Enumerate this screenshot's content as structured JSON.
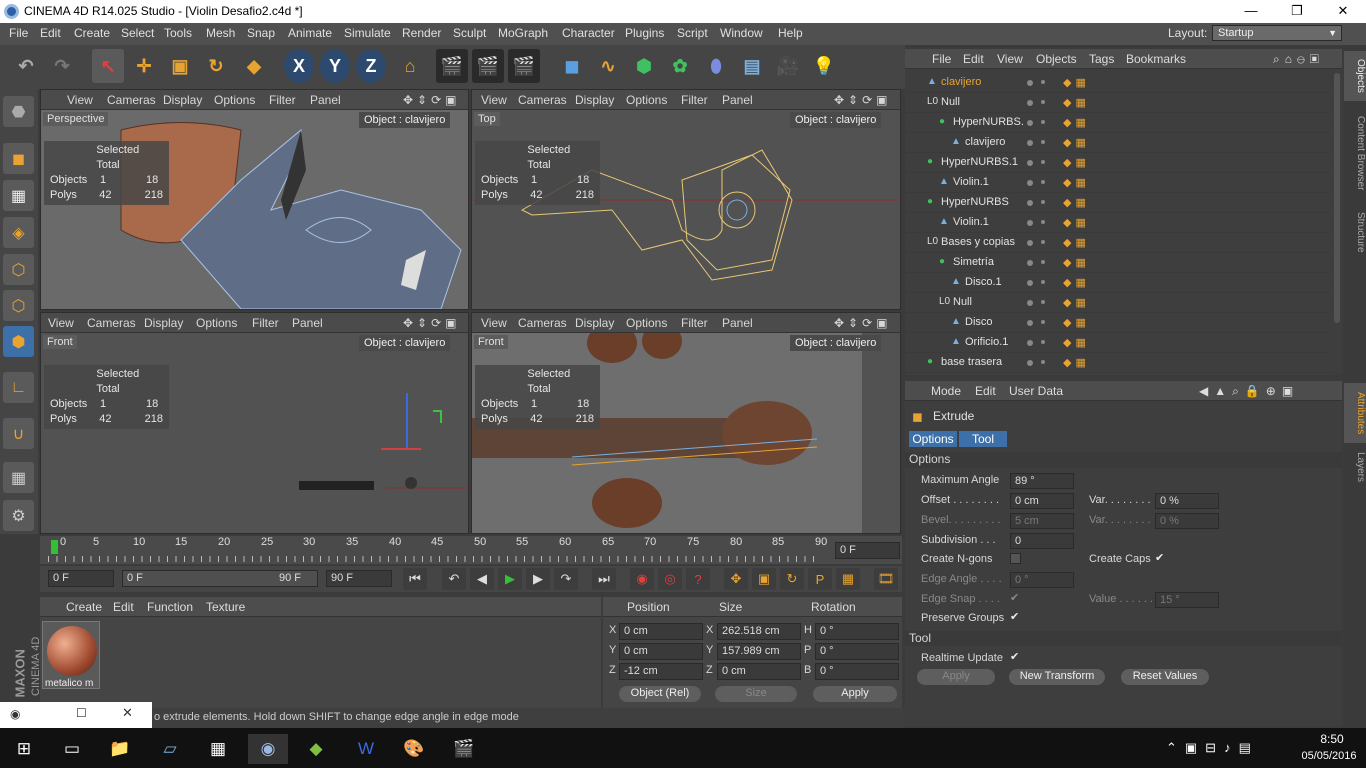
{
  "window": {
    "title": "CINEMA 4D R14.025 Studio - [Violin Desafio2.c4d *]",
    "minimize": "—",
    "restore": "❐",
    "close": "✕"
  },
  "menu": [
    "File",
    "Edit",
    "Create",
    "Select",
    "Tools",
    "Mesh",
    "Snap",
    "Animate",
    "Simulate",
    "Render",
    "Sculpt",
    "MoGraph",
    "Character",
    "Plugins",
    "Script",
    "Window",
    "Help"
  ],
  "layout": {
    "label": "Layout:",
    "value": "Startup"
  },
  "viewport_menu": [
    "View",
    "Cameras",
    "Display",
    "Options",
    "Filter",
    "Panel"
  ],
  "viewports": [
    {
      "name": "Perspective",
      "object": "Object : clavijero",
      "stats": {
        "header": "Selected Total",
        "objects_label": "Objects",
        "objects_sel": "1",
        "objects_total": "18",
        "polys_label": "Polys",
        "polys_sel": "42",
        "polys_total": "218"
      }
    },
    {
      "name": "Top",
      "object": "Object : clavijero",
      "stats": {
        "header": "Selected Total",
        "objects_label": "Objects",
        "objects_sel": "1",
        "objects_total": "18",
        "polys_label": "Polys",
        "polys_sel": "42",
        "polys_total": "218"
      }
    },
    {
      "name": "Front",
      "object": "Object : clavijero",
      "stats": {
        "header": "Selected Total",
        "objects_label": "Objects",
        "objects_sel": "1",
        "objects_total": "18",
        "polys_label": "Polys",
        "polys_sel": "42",
        "polys_total": "218"
      }
    },
    {
      "name": "Front",
      "object": "Object : clavijero",
      "stats": {
        "header": "Selected Total",
        "objects_label": "Objects",
        "objects_sel": "1",
        "objects_total": "18",
        "polys_label": "Polys",
        "polys_sel": "42",
        "polys_total": "218"
      }
    }
  ],
  "timeline": {
    "ticks": [
      "0",
      "5",
      "10",
      "15",
      "20",
      "25",
      "30",
      "35",
      "40",
      "45",
      "50",
      "55",
      "60",
      "65",
      "70",
      "75",
      "80",
      "85",
      "90"
    ],
    "frame_field": "0 F"
  },
  "transport": {
    "start": "0 F",
    "slider_left": "0 F",
    "slider_right": "90 F",
    "end": "90 F"
  },
  "material_menu": [
    "Create",
    "Edit",
    "Function",
    "Texture"
  ],
  "material": {
    "name": "metalico m"
  },
  "coords": {
    "headers": [
      "Position",
      "Size",
      "Rotation"
    ],
    "rows": [
      {
        "axis": "X",
        "pos": "0 cm",
        "saxis": "X",
        "size": "262.518 cm",
        "raxis": "H",
        "rot": "0 °"
      },
      {
        "axis": "Y",
        "pos": "0 cm",
        "saxis": "Y",
        "size": "157.989 cm",
        "raxis": "P",
        "rot": "0 °"
      },
      {
        "axis": "Z",
        "pos": "-12 cm",
        "saxis": "Z",
        "size": "0 cm",
        "raxis": "B",
        "rot": "0 °"
      }
    ],
    "mode": "Object (Rel)",
    "size_mode": "Size",
    "apply": "Apply"
  },
  "status": "o extrude elements. Hold down SHIFT to change edge angle in edge mode",
  "objects_menu": [
    "File",
    "Edit",
    "View",
    "Objects",
    "Tags",
    "Bookmarks"
  ],
  "objects": [
    {
      "name": "clavijero",
      "indent": 0,
      "icon": "▲",
      "color": "#e8a330"
    },
    {
      "name": "Null",
      "indent": 0,
      "icon": "L0",
      "color": "#e2e2e2"
    },
    {
      "name": "HyperNURBS.",
      "indent": 1,
      "icon": "●",
      "color": "#e2e2e2"
    },
    {
      "name": "clavijero",
      "indent": 2,
      "icon": "▲",
      "color": "#e2e2e2"
    },
    {
      "name": "HyperNURBS.1",
      "indent": 0,
      "icon": "●",
      "color": "#e2e2e2"
    },
    {
      "name": "Violin.1",
      "indent": 1,
      "icon": "▲",
      "color": "#e2e2e2"
    },
    {
      "name": "HyperNURBS",
      "indent": 0,
      "icon": "●",
      "color": "#e2e2e2"
    },
    {
      "name": "Violin.1",
      "indent": 1,
      "icon": "▲",
      "color": "#e2e2e2"
    },
    {
      "name": "Bases y copias",
      "indent": 0,
      "icon": "L0",
      "color": "#e2e2e2"
    },
    {
      "name": "Simetría",
      "indent": 1,
      "icon": "●",
      "color": "#e2e2e2"
    },
    {
      "name": "Disco.1",
      "indent": 2,
      "icon": "▲",
      "color": "#e2e2e2"
    },
    {
      "name": "Null",
      "indent": 1,
      "icon": "L0",
      "color": "#e2e2e2"
    },
    {
      "name": "Disco",
      "indent": 2,
      "icon": "▲",
      "color": "#e2e2e2"
    },
    {
      "name": "Orificio.1",
      "indent": 2,
      "icon": "▲",
      "color": "#e2e2e2"
    },
    {
      "name": "base trasera",
      "indent": 0,
      "icon": "●",
      "color": "#e2e2e2"
    }
  ],
  "attr_menu": [
    "Mode",
    "Edit",
    "User Data"
  ],
  "attributes": {
    "tool_name": "Extrude",
    "tabs": [
      "Options",
      "Tool"
    ],
    "section_options": "Options",
    "max_angle_label": "Maximum Angle",
    "max_angle": "89 °",
    "offset_label": "Offset . . . . . . . .",
    "offset": "0 cm",
    "var_label": "Var. . . . . . . .",
    "var": "0 %",
    "bevel_label": "Bevel. . . . . . . . .",
    "bevel": "5 cm",
    "var2_label": "Var. . . . . . . .",
    "var2": "0 %",
    "subdiv_label": "Subdivision . . .",
    "subdiv": "0",
    "ngons_label": "Create N-gons",
    "caps_label": "Create Caps",
    "edge_angle_label": "Edge Angle . . . .",
    "edge_angle": "0 °",
    "edge_snap_label": "Edge Snap . . . .",
    "value_label": "Value . . . . . .",
    "value": "15 °",
    "preserve_label": "Preserve Groups",
    "section_tool": "Tool",
    "realtime_label": "Realtime Update",
    "apply": "Apply",
    "new_transform": "New Transform",
    "reset": "Reset Values"
  },
  "side_tabs": [
    "Objects",
    "Content Browser",
    "Structure",
    "Attributes",
    "Layers"
  ],
  "logo": {
    "brand": "MAXON",
    "product": "CINEMA 4D"
  },
  "clock": {
    "time": "8:50",
    "date": "05/05/2016"
  },
  "colors": {
    "accent": "#e8a330",
    "selected_text": "#e8a330",
    "play": "#34c034"
  }
}
